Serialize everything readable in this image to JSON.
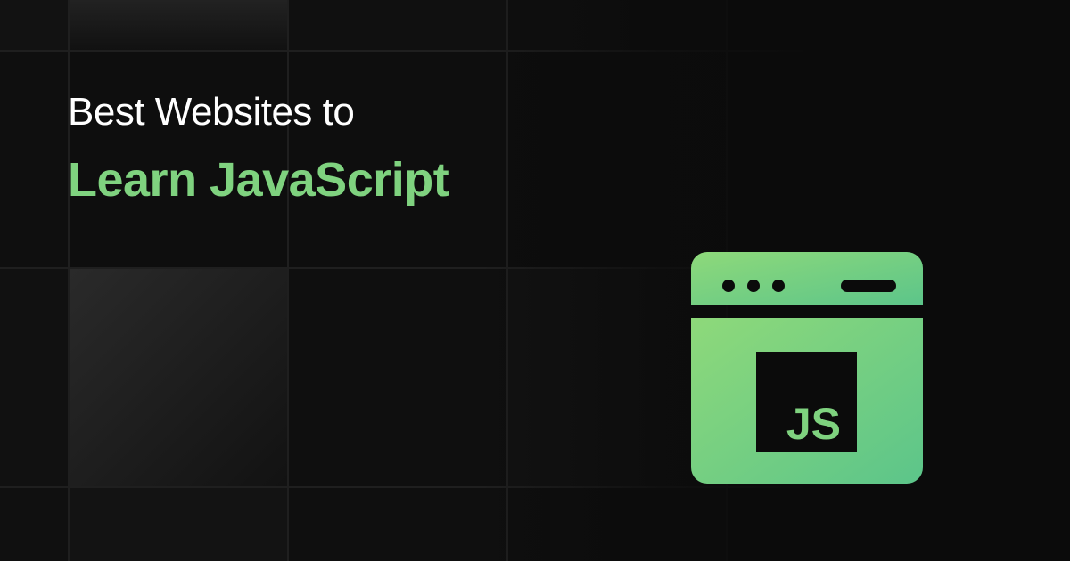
{
  "headline": {
    "line1": "Best Websites to",
    "line2": "Learn JavaScript"
  },
  "icon": {
    "name": "js-browser-icon",
    "badge_text": "JS"
  },
  "colors": {
    "background": "#0b0b0b",
    "accent_green": "#7fd27f",
    "accent_green_dark": "#5cc58a",
    "text_white": "#ffffff"
  }
}
